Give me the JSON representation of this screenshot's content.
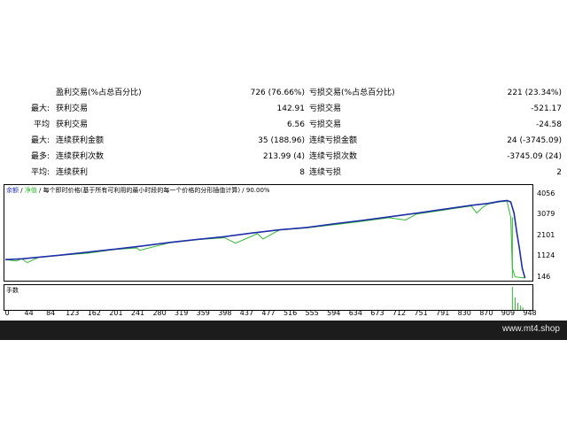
{
  "stats": {
    "rows": [
      {
        "pre": "",
        "label_a": "盈利交易(%占总百分比)",
        "value_a": "726 (76.66%)",
        "label_b": "亏损交易(%占总百分比)",
        "value_b": "221 (23.34%)"
      },
      {
        "pre": "最大:",
        "label_a": "获利交易",
        "value_a": "142.91",
        "label_b": "亏损交易",
        "value_b": "-521.17"
      },
      {
        "pre": "平均",
        "label_a": "获利交易",
        "value_a": "6.56",
        "label_b": "亏损交易",
        "value_b": "-24.58"
      },
      {
        "pre": "最大:",
        "label_a": "连续获利金额",
        "value_a": "35 (188.96)",
        "label_b": "连续亏损金额",
        "value_b": "24 (-3745.09)"
      },
      {
        "pre": "最多:",
        "label_a": "连续获利次数",
        "value_a": "213.99 (4)",
        "label_b": "连续亏损次数",
        "value_b": "-3745.09 (24)"
      },
      {
        "pre": "平均:",
        "label_a": "连续获利",
        "value_a": "8",
        "label_b": "连续亏损",
        "value_b": "2"
      }
    ]
  },
  "chart": {
    "legend": {
      "balance": "余额",
      "sep1": " / ",
      "equity": "净值",
      "sep2": " / ",
      "tick_text": "每个即时价格(基于所有可利用的最小时段的每一个价格的分形插值计算) / 90.00%"
    },
    "sub_label": "手数",
    "balance_color": "#1f2fa8",
    "equity_color": "#2fb82f"
  },
  "chart_data": {
    "type": "line",
    "x_ticks": [
      "0",
      "44",
      "84",
      "123",
      "162",
      "201",
      "241",
      "280",
      "319",
      "359",
      "398",
      "437",
      "477",
      "516",
      "555",
      "594",
      "634",
      "673",
      "712",
      "751",
      "791",
      "830",
      "870",
      "909",
      "948"
    ],
    "y_ticks": [
      "4056",
      "3079",
      "2101",
      "1124",
      "146"
    ],
    "ylim": [
      146,
      4056
    ],
    "xlim": [
      0,
      960
    ],
    "series": [
      {
        "name": "余额",
        "x": [
          0,
          30,
          60,
          100,
          150,
          200,
          250,
          300,
          350,
          400,
          450,
          500,
          550,
          600,
          650,
          700,
          750,
          800,
          850,
          880,
          900,
          915,
          922,
          928,
          933,
          938,
          943,
          948
        ],
        "y": [
          1010,
          1050,
          1120,
          1220,
          1360,
          1500,
          1650,
          1820,
          1960,
          2090,
          2260,
          2410,
          2520,
          2690,
          2850,
          3020,
          3190,
          3380,
          3560,
          3650,
          3740,
          3790,
          3720,
          3200,
          2300,
          1500,
          600,
          146
        ]
      },
      {
        "name": "净值",
        "x": [
          0,
          20,
          30,
          40,
          60,
          100,
          150,
          200,
          240,
          245,
          300,
          350,
          400,
          420,
          460,
          470,
          500,
          550,
          600,
          650,
          700,
          730,
          750,
          800,
          850,
          860,
          870,
          880,
          900,
          915,
          922,
          925,
          930,
          948
        ],
        "y": [
          1010,
          950,
          1050,
          870,
          1110,
          1210,
          1310,
          1490,
          1560,
          1450,
          1800,
          1950,
          2040,
          1780,
          2230,
          1980,
          2400,
          2500,
          2650,
          2810,
          2980,
          2870,
          3150,
          3340,
          3530,
          3200,
          3450,
          3620,
          3720,
          3760,
          3000,
          600,
          200,
          146
        ]
      }
    ]
  }
}
